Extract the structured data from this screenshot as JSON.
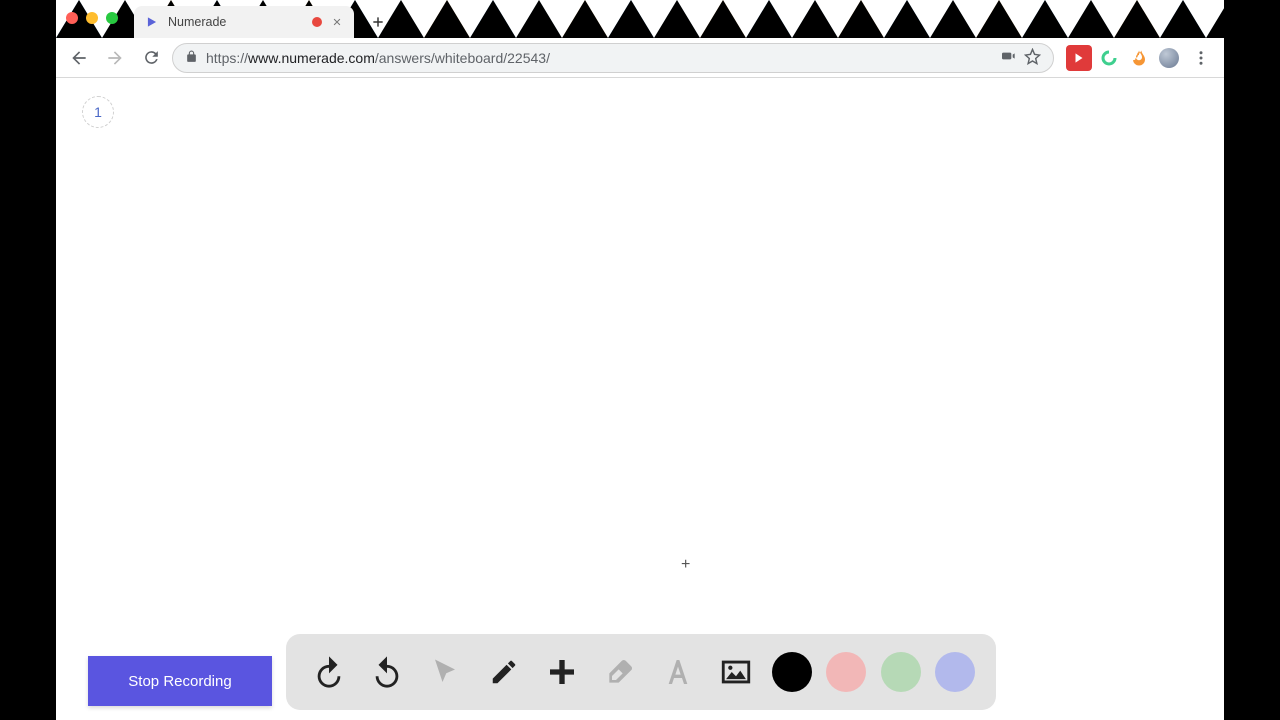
{
  "browser": {
    "tab_title": "Numerade",
    "url_protocol": "https://",
    "url_host": "www.numerade.com",
    "url_path": "/answers/whiteboard/22543/"
  },
  "whiteboard": {
    "page_number": "1",
    "cursor_glyph": "+"
  },
  "recording": {
    "button_label": "Stop Recording"
  },
  "tools": {
    "undo": "undo-icon",
    "redo": "redo-icon",
    "pointer": "pointer-icon",
    "pencil": "pencil-icon",
    "plus": "plus-icon",
    "eraser": "eraser-icon",
    "text": "text-icon",
    "image": "image-icon"
  },
  "colors": {
    "black": "#000000",
    "pink": "#f2b7b7",
    "green": "#b6d9b6",
    "blue": "#b2b9ec"
  }
}
